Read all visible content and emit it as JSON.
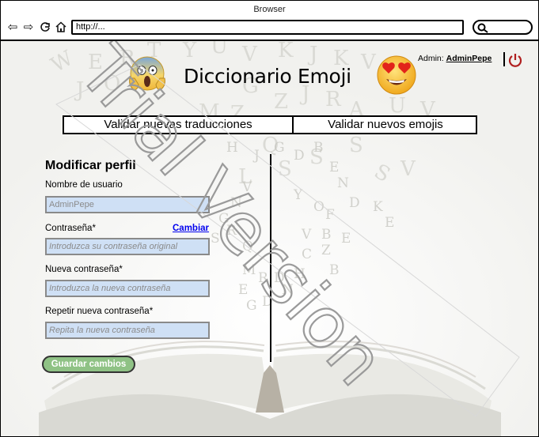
{
  "window": {
    "title": "Browser"
  },
  "toolbar": {
    "url": "http://..."
  },
  "header": {
    "title": "Diccionario Emoji",
    "admin_label": "Admin:",
    "admin_user": "AdminPepe"
  },
  "nav": [
    {
      "label": "Validar nuevas traducciones"
    },
    {
      "label": "Validar nuevos emojis"
    }
  ],
  "form": {
    "title": "Modificar perfil",
    "username_label": "Nombre de usuario",
    "username_value": "AdminPepe",
    "password_label": "Contraseña*",
    "change_link": "Cambiar",
    "password_placeholder": "Introduzca su contraseña original",
    "new_password_label": "Nueva contraseña*",
    "new_password_placeholder": "Introduzca la nueva contraseña",
    "repeat_password_label": "Repetir nueva contraseña*",
    "repeat_password_placeholder": "Repita la nueva contraseña",
    "save_label": "Guardar cambios"
  },
  "watermark": {
    "text": "Trial Version"
  },
  "colors": {
    "field_bg": "#cfe0f5",
    "save_button": "#8fc285",
    "link": "#0000ee",
    "power": "#b01e1e"
  }
}
